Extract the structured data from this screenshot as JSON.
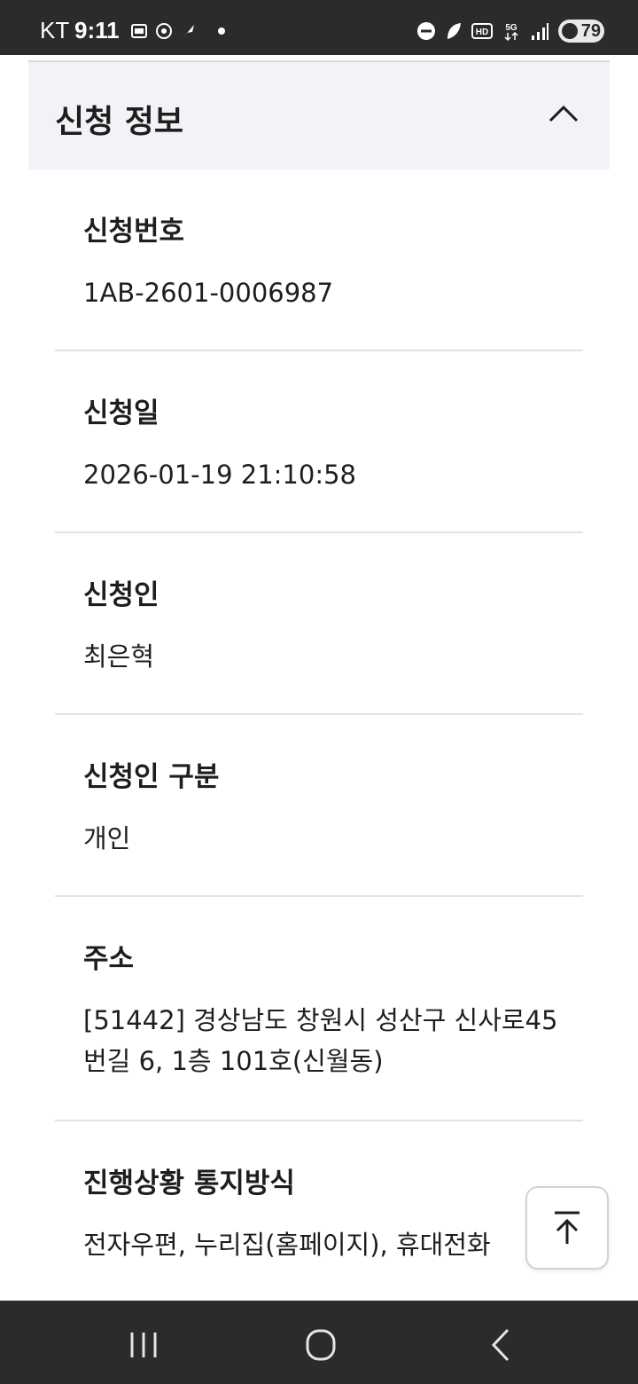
{
  "status_bar": {
    "carrier": "KT",
    "time": "9:11",
    "battery": "79"
  },
  "panel": {
    "title": "신청 정보"
  },
  "fields": [
    {
      "label": "신청번호",
      "value": "1AB-2601-0006987"
    },
    {
      "label": "신청일",
      "value": "2026-01-19 21:10:58"
    },
    {
      "label": "신청인",
      "value": "최은혁"
    },
    {
      "label": "신청인 구분",
      "value": "개인"
    },
    {
      "label": "주소",
      "value": "[51442] 경상남도 창원시 성산구 신사로45번길 6, 1층 101호(신월동)"
    },
    {
      "label": "진행상황 통지방식",
      "value": "전자우편, 누리집(홈페이지), 휴대전화"
    }
  ],
  "icons": {
    "collapse": "chevron-up-icon",
    "scroll_top": "arrow-up-to-top-icon",
    "nav_recent": "recent-apps-icon",
    "nav_home": "home-icon",
    "nav_back": "back-icon"
  }
}
